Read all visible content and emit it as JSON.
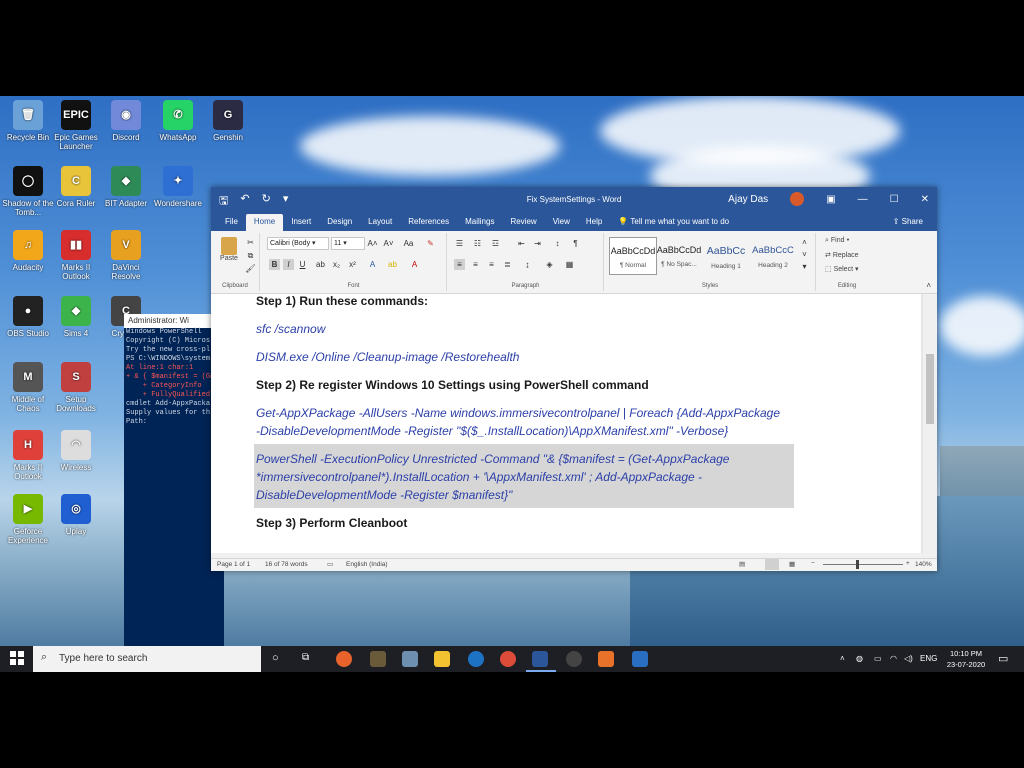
{
  "desktop": {
    "icons": [
      {
        "label": "Recycle Bin",
        "color": "#6aa2d8",
        "glyph": "🗑"
      },
      {
        "label": "Epic Games Launcher",
        "color": "#111111",
        "glyph": "EPIC"
      },
      {
        "label": "Discord",
        "color": "#7289da",
        "glyph": "◉"
      },
      {
        "label": "WhatsApp",
        "color": "#25d366",
        "glyph": "✆"
      },
      {
        "label": "Genshin",
        "color": "#2b2b44",
        "glyph": "G"
      },
      {
        "label": "Shadow of the Tomb...",
        "color": "#111111",
        "glyph": "◯"
      },
      {
        "label": "Cora Ruler",
        "color": "#e8c43a",
        "glyph": "C"
      },
      {
        "label": "BIT Adapter",
        "color": "#2e8b57",
        "glyph": "◆"
      },
      {
        "label": "Wondershare",
        "color": "#2d6fd3",
        "glyph": "✦"
      },
      {
        "label": "Audacity",
        "color": "#f2a71b",
        "glyph": "♫"
      },
      {
        "label": "Marks II Outlook",
        "color": "#d72d2d",
        "glyph": "▮▮"
      },
      {
        "label": "DaVinci Resolve",
        "color": "#e8a020",
        "glyph": "V"
      },
      {
        "label": "OBS Studio",
        "color": "#222222",
        "glyph": "●"
      },
      {
        "label": "Sims 4",
        "color": "#3cb44b",
        "glyph": "◆"
      },
      {
        "label": "Crysis 3",
        "color": "#444444",
        "glyph": "C"
      },
      {
        "label": "Middle of Chaos",
        "color": "#555555",
        "glyph": "M"
      },
      {
        "label": "Setup Downloads",
        "color": "#c04040",
        "glyph": "S"
      },
      {
        "label": "Marks II Outlook",
        "color": "#e0403a",
        "glyph": "H"
      },
      {
        "label": "Wireless",
        "color": "#dddddd",
        "glyph": "◠"
      },
      {
        "label": "Geforce Experience",
        "color": "#76b900",
        "glyph": "▶"
      },
      {
        "label": "Uplay",
        "color": "#1f5fd1",
        "glyph": "◎"
      }
    ]
  },
  "powershell": {
    "title": "Administrator: Wi",
    "lines": [
      "Windows PowerShell",
      "Copyright (C) Micros",
      "",
      "Try the new cross-pl",
      "",
      "PS C:\\WINDOWS\\system",
      "",
      "At line:1 char:1",
      "+ & { $manifest = (Get-AppxPack",
      "",
      "    + CategoryInfo",
      "    + FullyQualified",
      "",
      "",
      "cmdlet Add-AppxPacka",
      "Supply values for th",
      "Path:"
    ],
    "error_lines": [
      2,
      7,
      8,
      9,
      10,
      11
    ]
  },
  "word": {
    "title": "Fix SystemSettings  -  Word",
    "user": "Ajay Das",
    "tabs": [
      "File",
      "Home",
      "Insert",
      "Design",
      "Layout",
      "References",
      "Mailings",
      "Review",
      "View",
      "Help"
    ],
    "active_tab": "Home",
    "tell_me": "Tell me what you want to do",
    "share": "Share",
    "ribbon": {
      "clipboard": {
        "paste": "Paste",
        "label": "Clipboard"
      },
      "font": {
        "family": "Calibri (Body",
        "size": "11",
        "label": "Font"
      },
      "paragraph": {
        "label": "Paragraph"
      },
      "styles": {
        "label": "Styles",
        "items": [
          {
            "sample": "AaBbCcDd",
            "name": "¶ Normal"
          },
          {
            "sample": "AaBbCcDd",
            "name": "¶ No Spac..."
          },
          {
            "sample": "AaBbCc",
            "name": "Heading 1"
          },
          {
            "sample": "AaBbCcC",
            "name": "Heading 2"
          }
        ]
      },
      "editing": {
        "find": "Find",
        "replace": "Replace",
        "select": "Select",
        "label": "Editing"
      }
    },
    "document": {
      "step1": "Step 1) Run these commands:",
      "cmd1": "sfc /scannow",
      "cmd2": "DISM.exe /Online /Cleanup-image /Restorehealth",
      "step2": "Step 2) Re register Windows 10 Settings using PowerShell command",
      "cmd3a": "Get-AppXPackage -AllUsers -Name windows.immersivecontrolpanel | Foreach {Add-AppxPackage",
      "cmd3b": "-DisableDevelopmentMode -Register \"$($_.InstallLocation)\\AppXManifest.xml\" -Verbose}",
      "cmd4a": "PowerShell -ExecutionPolicy Unrestricted -Command \"& {$manifest = (Get-AppxPackage",
      "cmd4b": "*immersivecontrolpanel*).InstallLocation + '\\AppxManifest.xml' ; Add-AppxPackage -",
      "cmd4c": "DisableDevelopmentMode -Register $manifest}\"",
      "step3": "Step 3) Perform Cleanboot"
    },
    "status": {
      "page": "Page 1 of 1",
      "words": "16 of 78 words",
      "language": "English (India)",
      "zoom": "140%"
    }
  },
  "taskbar": {
    "search_placeholder": "Type here to search",
    "language": "ENG",
    "time": "10:10 PM",
    "date": "23-07-2020"
  }
}
